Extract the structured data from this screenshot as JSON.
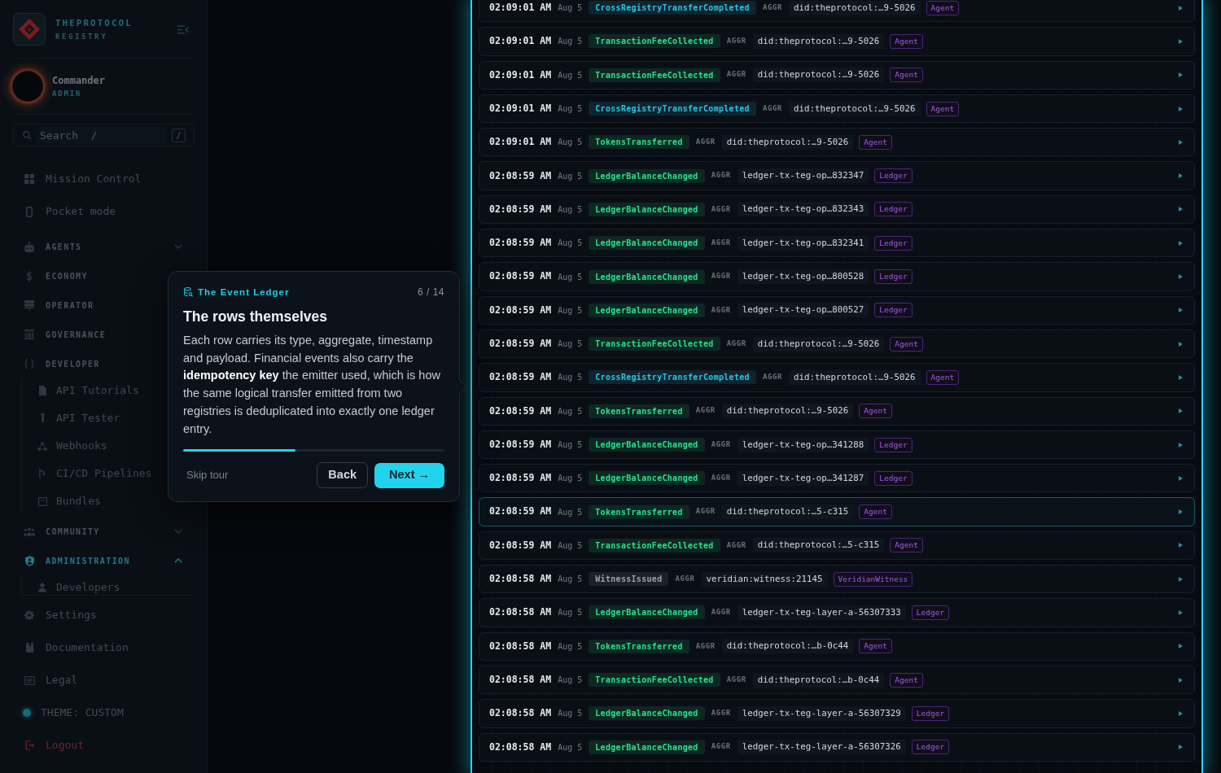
{
  "sidebar": {
    "brand": {
      "name": "THEPROTOCOL",
      "subtitle": "REGISTRY"
    },
    "user": {
      "name": "Commander",
      "role": "ADMIN"
    },
    "search": {
      "placeholder": "Search  /",
      "shortcut": "/"
    },
    "nav": [
      {
        "kind": "link",
        "label": "Mission Control",
        "selected": false
      },
      {
        "kind": "link",
        "label": "Pocket mode",
        "selected": false
      },
      {
        "kind": "section",
        "label": "AGENTS",
        "selected": false,
        "collapsible": true,
        "expanded": false
      },
      {
        "kind": "section",
        "label": "ECONOMY",
        "selected": false
      },
      {
        "kind": "section",
        "label": "OPERATOR",
        "selected": false
      },
      {
        "kind": "section",
        "label": "GOVERNANCE",
        "selected": false
      },
      {
        "kind": "section",
        "label": "DEVELOPER",
        "selected": false,
        "expanded": true,
        "children": [
          {
            "label": "API Tutorials",
            "selected": false
          },
          {
            "label": "API Tester",
            "selected": false
          },
          {
            "label": "Webhooks",
            "selected": false
          },
          {
            "label": "CI/CD Pipelines",
            "selected": false
          },
          {
            "label": "Bundles",
            "selected": false
          }
        ]
      },
      {
        "kind": "section",
        "label": "COMMUNITY",
        "selected": false,
        "collapsible": true,
        "expanded": false
      },
      {
        "kind": "section",
        "label": "ADMINISTRATION",
        "selected": true,
        "collapsible": true,
        "expanded": true,
        "children": [
          {
            "label": "Developers",
            "selected": false
          }
        ]
      }
    ],
    "footer": [
      {
        "kind": "link",
        "label": "Settings"
      },
      {
        "kind": "link",
        "label": "Documentation"
      },
      {
        "kind": "link",
        "label": "Legal"
      },
      {
        "kind": "theme",
        "label": "THEME: CUSTOM"
      },
      {
        "kind": "logout",
        "label": "Logout"
      }
    ]
  },
  "tour": {
    "section": "The Event Ledger",
    "step": "6 / 14",
    "title": "The rows themselves",
    "body": "Each row carries its type, aggregate, timestamp and payload. Financial events also carry the **idempotency key** the emitter used, which is how the same logical transfer emitted from two registries is deduplicated into exactly one ledger entry.",
    "level": 0.43,
    "skip": "Skip tour",
    "back": "Back",
    "next": "Next →"
  },
  "events": {
    "rows": [
      {
        "time": "02:09:01 AM",
        "date": "Aug 5",
        "type": {
          "label": "CrossRegistryTransferCompleted",
          "color": "#2bc4e4"
        },
        "aggr_label": "AGGR",
        "aggregate": "did:theprotocol:…9-5026",
        "tag": "Agent",
        "selected": false
      },
      {
        "time": "02:09:01 AM",
        "date": "Aug 5",
        "type": {
          "label": "TransactionFeeCollected",
          "color": "#27e28c"
        },
        "aggr_label": "AGGR",
        "aggregate": "did:theprotocol:…9-5026",
        "tag": "Agent",
        "selected": false
      },
      {
        "time": "02:09:01 AM",
        "date": "Aug 5",
        "type": {
          "label": "TransactionFeeCollected",
          "color": "#27e28c"
        },
        "aggr_label": "AGGR",
        "aggregate": "did:theprotocol:…9-5026",
        "tag": "Agent",
        "selected": false
      },
      {
        "time": "02:09:01 AM",
        "date": "Aug 5",
        "type": {
          "label": "CrossRegistryTransferCompleted",
          "color": "#2bc4e4"
        },
        "aggr_label": "AGGR",
        "aggregate": "did:theprotocol:…9-5026",
        "tag": "Agent",
        "selected": false
      },
      {
        "time": "02:09:01 AM",
        "date": "Aug 5",
        "type": {
          "label": "TokensTransferred",
          "color": "#27e28c"
        },
        "aggr_label": "AGGR",
        "aggregate": "did:theprotocol:…9-5026",
        "tag": "Agent",
        "selected": false
      },
      {
        "time": "02:08:59 AM",
        "date": "Aug 5",
        "type": {
          "label": "LedgerBalanceChanged",
          "color": "#27e28c"
        },
        "aggr_label": "AGGR",
        "aggregate": "ledger-tx-teg-op…832347",
        "tag": "Ledger",
        "selected": false
      },
      {
        "time": "02:08:59 AM",
        "date": "Aug 5",
        "type": {
          "label": "LedgerBalanceChanged",
          "color": "#27e28c"
        },
        "aggr_label": "AGGR",
        "aggregate": "ledger-tx-teg-op…832343",
        "tag": "Ledger",
        "selected": false
      },
      {
        "time": "02:08:59 AM",
        "date": "Aug 5",
        "type": {
          "label": "LedgerBalanceChanged",
          "color": "#27e28c"
        },
        "aggr_label": "AGGR",
        "aggregate": "ledger-tx-teg-op…832341",
        "tag": "Ledger",
        "selected": false
      },
      {
        "time": "02:08:59 AM",
        "date": "Aug 5",
        "type": {
          "label": "LedgerBalanceChanged",
          "color": "#27e28c"
        },
        "aggr_label": "AGGR",
        "aggregate": "ledger-tx-teg-op…800528",
        "tag": "Ledger",
        "selected": false
      },
      {
        "time": "02:08:59 AM",
        "date": "Aug 5",
        "type": {
          "label": "LedgerBalanceChanged",
          "color": "#27e28c"
        },
        "aggr_label": "AGGR",
        "aggregate": "ledger-tx-teg-op…800527",
        "tag": "Ledger",
        "selected": false
      },
      {
        "time": "02:08:59 AM",
        "date": "Aug 5",
        "type": {
          "label": "TransactionFeeCollected",
          "color": "#27e28c"
        },
        "aggr_label": "AGGR",
        "aggregate": "did:theprotocol:…9-5026",
        "tag": "Agent",
        "selected": false
      },
      {
        "time": "02:08:59 AM",
        "date": "Aug 5",
        "type": {
          "label": "CrossRegistryTransferCompleted",
          "color": "#2bc4e4"
        },
        "aggr_label": "AGGR",
        "aggregate": "did:theprotocol:…9-5026",
        "tag": "Agent",
        "selected": false
      },
      {
        "time": "02:08:59 AM",
        "date": "Aug 5",
        "type": {
          "label": "TokensTransferred",
          "color": "#27e28c"
        },
        "aggr_label": "AGGR",
        "aggregate": "did:theprotocol:…9-5026",
        "tag": "Agent",
        "selected": false
      },
      {
        "time": "02:08:59 AM",
        "date": "Aug 5",
        "type": {
          "label": "LedgerBalanceChanged",
          "color": "#27e28c"
        },
        "aggr_label": "AGGR",
        "aggregate": "ledger-tx-teg-op…341288",
        "tag": "Ledger",
        "selected": false
      },
      {
        "time": "02:08:59 AM",
        "date": "Aug 5",
        "type": {
          "label": "LedgerBalanceChanged",
          "color": "#27e28c"
        },
        "aggr_label": "AGGR",
        "aggregate": "ledger-tx-teg-op…341287",
        "tag": "Ledger",
        "selected": false
      },
      {
        "time": "02:08:59 AM",
        "date": "Aug 5",
        "type": {
          "label": "TokensTransferred",
          "color": "#27e28c"
        },
        "aggr_label": "AGGR",
        "aggregate": "did:theprotocol:…5-c315",
        "tag": "Agent",
        "selected": true
      },
      {
        "time": "02:08:59 AM",
        "date": "Aug 5",
        "type": {
          "label": "TransactionFeeCollected",
          "color": "#27e28c"
        },
        "aggr_label": "AGGR",
        "aggregate": "did:theprotocol:…5-c315",
        "tag": "Agent",
        "selected": false
      },
      {
        "time": "02:08:58 AM",
        "date": "Aug 5",
        "type": {
          "label": "WitnessIssued",
          "color": "#9aa2ab"
        },
        "aggr_label": "AGGR",
        "aggregate": "veridian:witness:21145",
        "tag": "VeridianWitness",
        "selected": false
      },
      {
        "time": "02:08:58 AM",
        "date": "Aug 5",
        "type": {
          "label": "LedgerBalanceChanged",
          "color": "#27e28c"
        },
        "aggr_label": "AGGR",
        "aggregate": "ledger-tx-teg-layer-a-56307333",
        "tag": "Ledger",
        "selected": false
      },
      {
        "time": "02:08:58 AM",
        "date": "Aug 5",
        "type": {
          "label": "TokensTransferred",
          "color": "#27e28c"
        },
        "aggr_label": "AGGR",
        "aggregate": "did:theprotocol:…b-0c44",
        "tag": "Agent",
        "selected": false
      },
      {
        "time": "02:08:58 AM",
        "date": "Aug 5",
        "type": {
          "label": "TransactionFeeCollected",
          "color": "#27e28c"
        },
        "aggr_label": "AGGR",
        "aggregate": "did:theprotocol:…b-0c44",
        "tag": "Agent",
        "selected": false
      },
      {
        "time": "02:08:58 AM",
        "date": "Aug 5",
        "type": {
          "label": "LedgerBalanceChanged",
          "color": "#27e28c"
        },
        "aggr_label": "AGGR",
        "aggregate": "ledger-tx-teg-layer-a-56307329",
        "tag": "Ledger",
        "selected": false
      },
      {
        "time": "02:08:58 AM",
        "date": "Aug 5",
        "type": {
          "label": "LedgerBalanceChanged",
          "color": "#27e28c"
        },
        "aggr_label": "AGGR",
        "aggregate": "ledger-tx-teg-layer-a-56307326",
        "tag": "Ledger",
        "selected": false
      }
    ]
  }
}
